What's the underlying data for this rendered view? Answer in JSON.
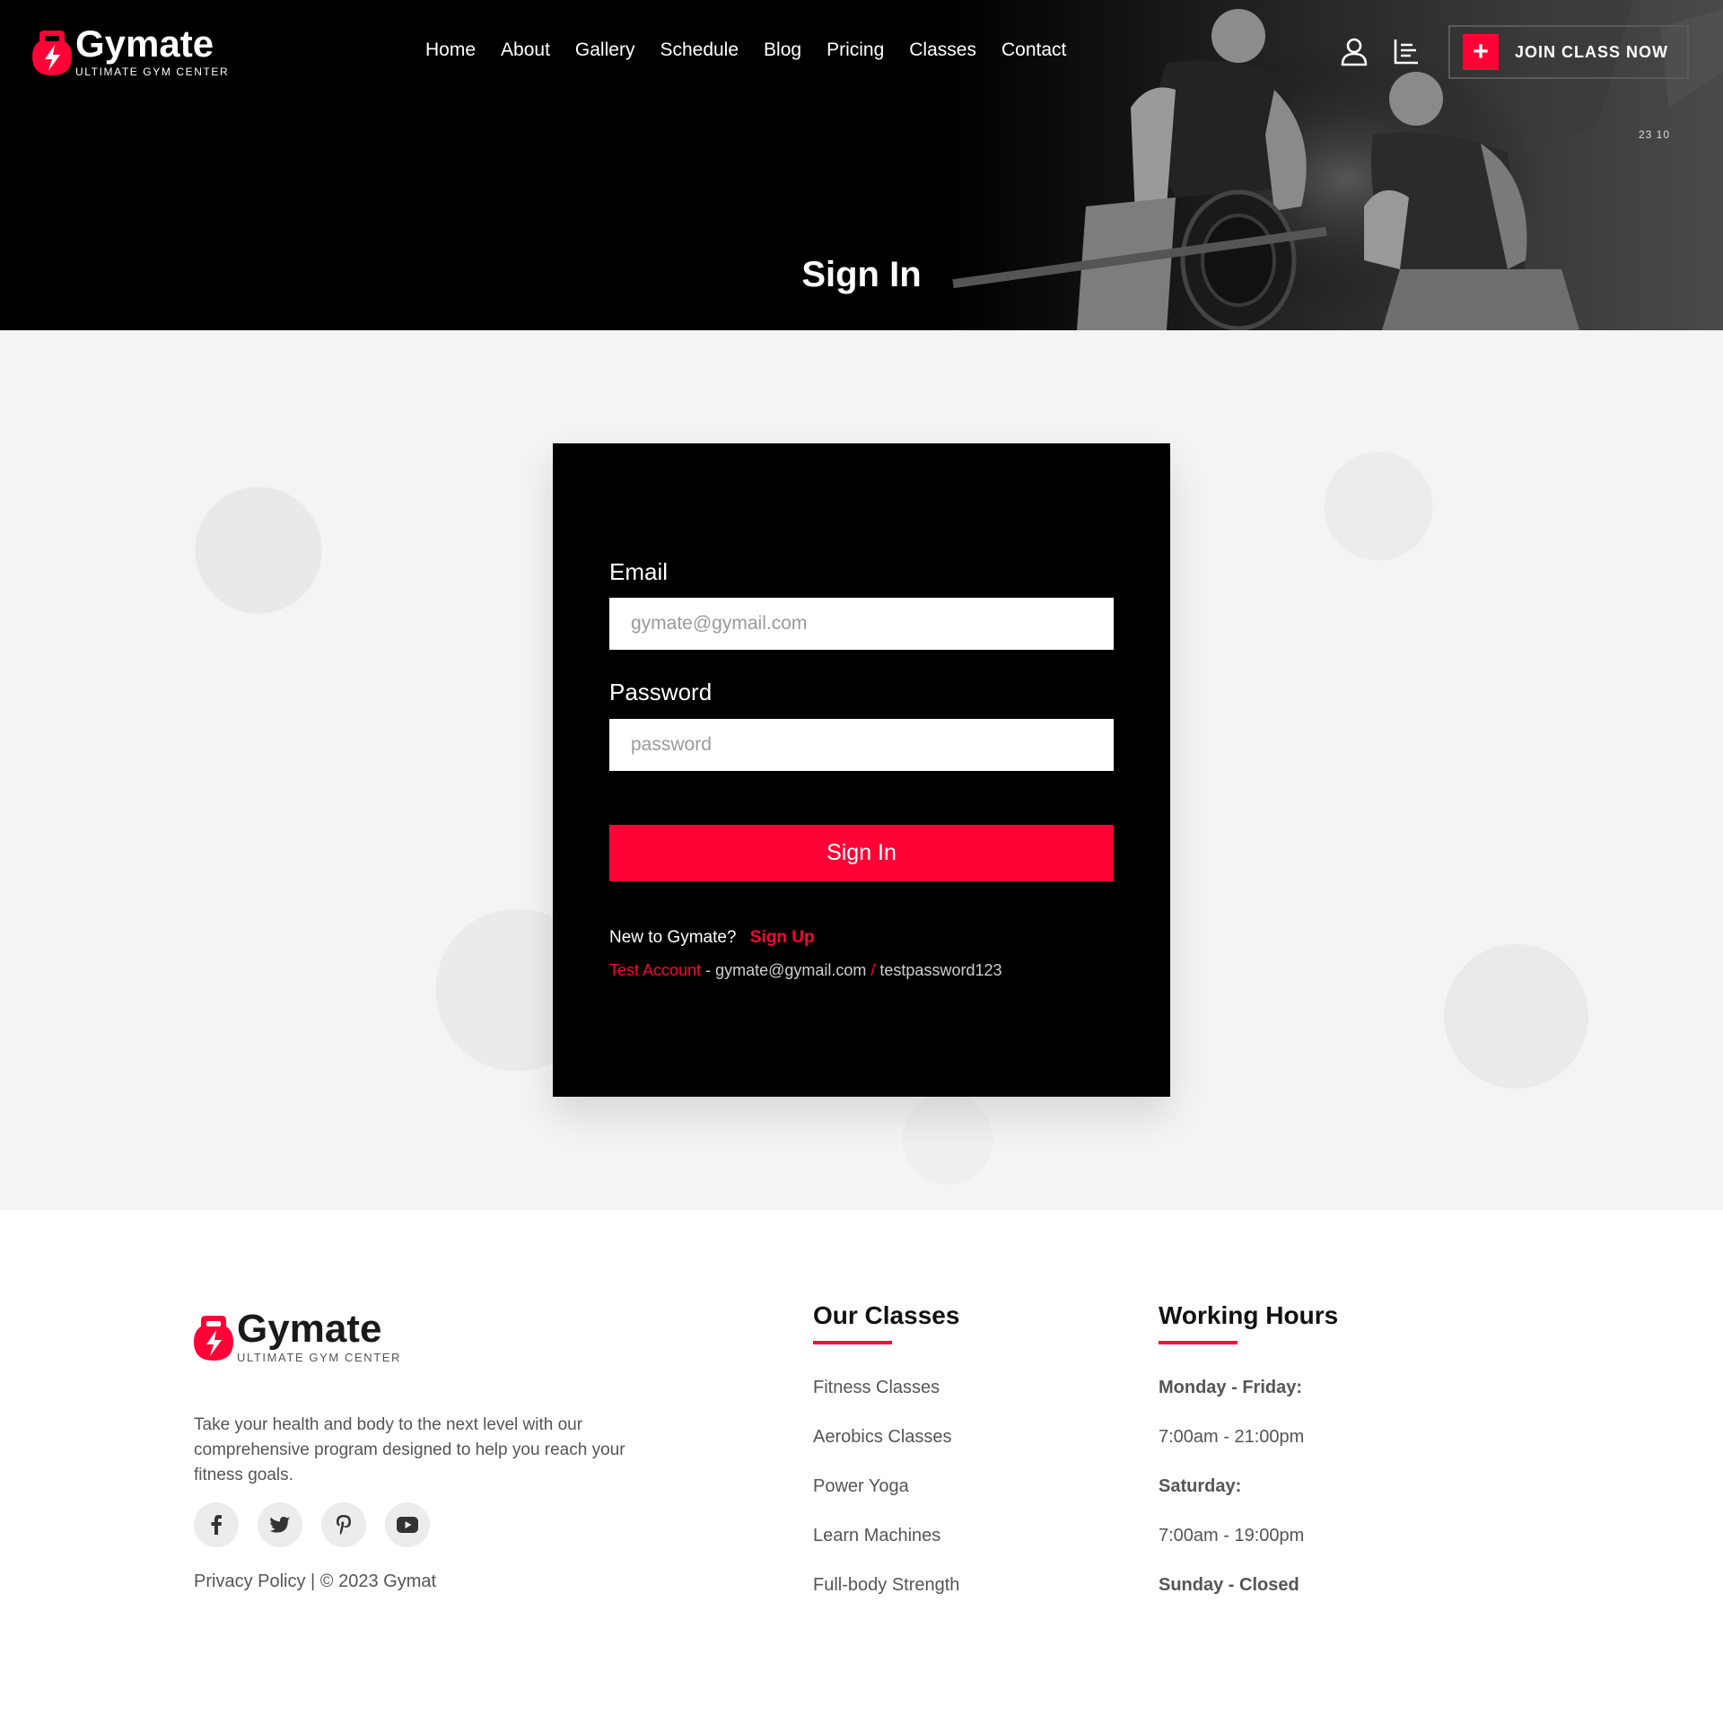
{
  "brand": {
    "name": "Gymate",
    "tagline": "ULTIMATE GYM CENTER",
    "accent": "#ff0336"
  },
  "nav": {
    "items": [
      {
        "label": "Home"
      },
      {
        "label": "About"
      },
      {
        "label": "Gallery"
      },
      {
        "label": "Schedule"
      },
      {
        "label": "Blog"
      },
      {
        "label": "Pricing"
      },
      {
        "label": "Classes"
      },
      {
        "label": "Contact"
      }
    ],
    "icons": [
      "user-icon",
      "menu-icon"
    ],
    "cta": {
      "plus": "+",
      "label": "JOIN CLASS NOW"
    }
  },
  "hero": {
    "title": "Sign In",
    "counter": "23 10"
  },
  "signin": {
    "email_label": "Email",
    "email_placeholder": "gymate@gymail.com",
    "password_label": "Password",
    "password_placeholder": "password",
    "submit_label": "Sign In",
    "new_prompt": "New to Gymate?",
    "signup_label": "Sign Up",
    "test_label": "Test Account",
    "test_sep1": " - ",
    "test_email": "gymate@gymail.com",
    "test_sep2": " / ",
    "test_password": "testpassword123"
  },
  "footer": {
    "about": "Take your health and body to the next level with our comprehensive program designed to help you reach your fitness goals.",
    "socials": [
      "facebook-icon",
      "twitter-icon",
      "pinterest-icon",
      "youtube-icon"
    ],
    "privacy": "Privacy Policy",
    "copyright": " | © 2023 Gymat",
    "classes_title": "Our Classes",
    "classes": [
      "Fitness Classes",
      "Aerobics Classes",
      "Power Yoga",
      "Learn Machines",
      "Full-body Strength"
    ],
    "hours_title": "Working Hours",
    "hours": [
      {
        "text": "Monday - Friday:",
        "bold": true
      },
      {
        "text": "7:00am - 21:00pm",
        "bold": false
      },
      {
        "text": "Saturday:",
        "bold": true
      },
      {
        "text": "7:00am - 19:00pm",
        "bold": false
      },
      {
        "text": "Sunday - Closed",
        "bold": true
      }
    ]
  }
}
